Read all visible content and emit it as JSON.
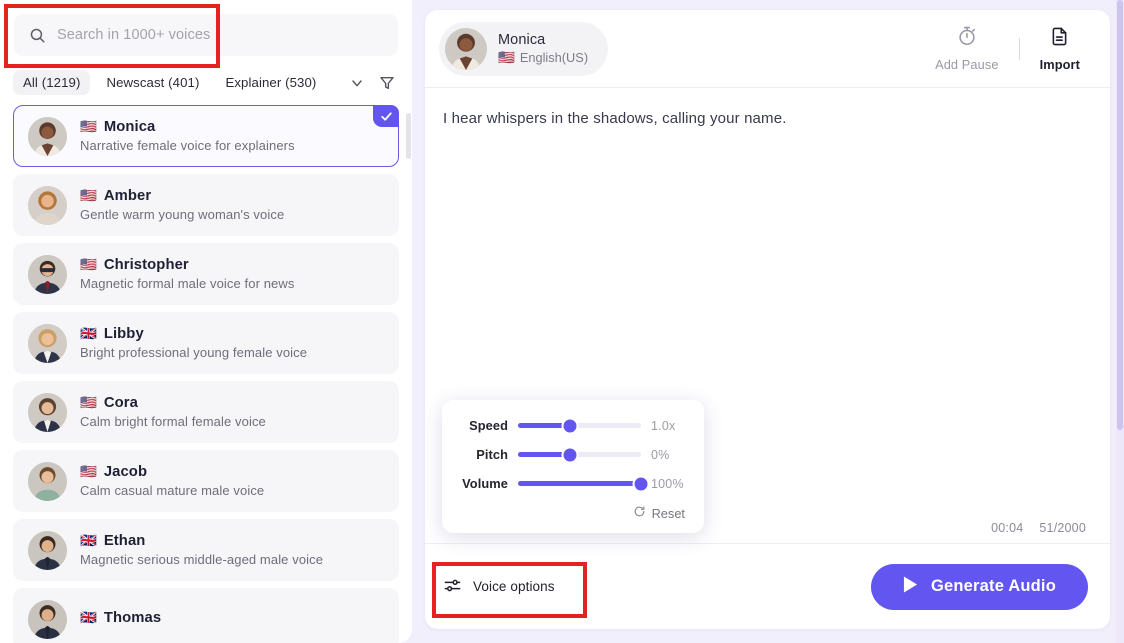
{
  "sidebar": {
    "search": {
      "placeholder": "Search in 1000+ voices",
      "value": "",
      "icon": "search-icon"
    },
    "filters": {
      "chips": [
        {
          "label": "All (1219)",
          "active": true
        },
        {
          "label": "Newscast (401)",
          "active": false
        },
        {
          "label": "Explainer (530)",
          "active": false
        }
      ],
      "expand_icon": "chevron-down-icon",
      "filter_icon": "funnel-filter-icon"
    },
    "voices": [
      {
        "flag": "🇺🇸",
        "name": "Monica",
        "desc": "Narrative female voice for explainers",
        "selected": true
      },
      {
        "flag": "🇺🇸",
        "name": "Amber",
        "desc": "Gentle warm young woman's voice",
        "selected": false
      },
      {
        "flag": "🇺🇸",
        "name": "Christopher",
        "desc": "Magnetic formal male voice for news",
        "selected": false
      },
      {
        "flag": "🇬🇧",
        "name": "Libby",
        "desc": "Bright professional young female voice",
        "selected": false
      },
      {
        "flag": "🇺🇸",
        "name": "Cora",
        "desc": "Calm bright formal female voice",
        "selected": false
      },
      {
        "flag": "🇺🇸",
        "name": "Jacob",
        "desc": "Calm casual mature male voice",
        "selected": false
      },
      {
        "flag": "🇬🇧",
        "name": "Ethan",
        "desc": "Magnetic serious middle-aged male voice",
        "selected": false
      },
      {
        "flag": "🇬🇧",
        "name": "Thomas",
        "desc": "",
        "selected": false
      }
    ]
  },
  "main": {
    "header": {
      "voice_name": "Monica",
      "voice_flag": "🇺🇸",
      "voice_language": "English(US)",
      "add_pause_label": "Add Pause",
      "add_pause_icon": "stopwatch-icon",
      "import_label": "Import",
      "import_icon": "document-import-icon"
    },
    "editor": {
      "text": "I hear whispers in the shadows, calling your name.",
      "duration": "00:04",
      "char_count": "51/2000"
    },
    "voice_options_popover": {
      "sliders": [
        {
          "label": "Speed",
          "value_text": "1.0x",
          "percent": 42
        },
        {
          "label": "Pitch",
          "value_text": "0%",
          "percent": 42
        },
        {
          "label": "Volume",
          "value_text": "100%",
          "percent": 100
        }
      ],
      "reset_label": "Reset",
      "reset_icon": "refresh-icon"
    },
    "footer": {
      "voice_options_label": "Voice options",
      "voice_options_icon": "sliders-settings-icon",
      "generate_label": "Generate Audio",
      "generate_icon": "play-triangle-icon"
    }
  },
  "colors": {
    "accent": "#6355ef",
    "accent_border": "#6b5ce0",
    "page_bg": "#f2effc",
    "annotation_red": "#e2231f",
    "item_bg": "#f6f6f8",
    "muted_text": "#6e6e7a"
  }
}
